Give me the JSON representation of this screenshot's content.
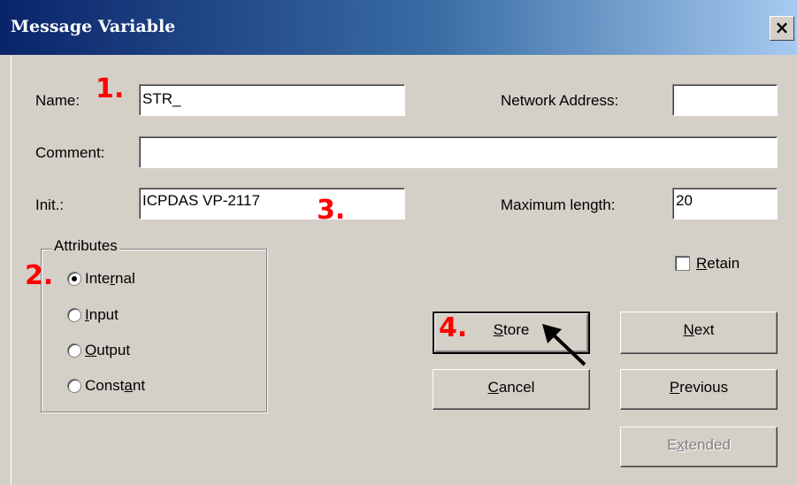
{
  "window": {
    "title": "Message Variable",
    "close_label": "×"
  },
  "fields": {
    "name": {
      "label": "Name:",
      "value": "STR_"
    },
    "network_address": {
      "label": "Network Address:",
      "value": ""
    },
    "comment": {
      "label": "Comment:",
      "value": ""
    },
    "init": {
      "label": "Init.:",
      "value": "ICPDAS VP-2117"
    },
    "max_length": {
      "label": "Maximum length:",
      "value": "20"
    }
  },
  "attributes": {
    "legend": "Attributes",
    "options": [
      {
        "pre": "Inte",
        "ul": "r",
        "post": "nal",
        "selected": true
      },
      {
        "pre": "",
        "ul": "I",
        "post": "nput",
        "selected": false
      },
      {
        "pre": "",
        "ul": "O",
        "post": "utput",
        "selected": false
      },
      {
        "pre": "Const",
        "ul": "a",
        "post": "nt",
        "selected": false
      }
    ]
  },
  "retain": {
    "pre": "",
    "ul": "R",
    "post": "etain",
    "checked": false
  },
  "buttons": {
    "store": {
      "pre": "",
      "ul": "S",
      "post": "tore"
    },
    "next": {
      "pre": "",
      "ul": "N",
      "post": "ext"
    },
    "cancel": {
      "pre": "",
      "ul": "C",
      "post": "ancel"
    },
    "previous": {
      "pre": "",
      "ul": "P",
      "post": "revious"
    },
    "extended": {
      "pre": "E",
      "ul": "x",
      "post": "tended",
      "disabled": true
    }
  },
  "annotations": {
    "step1": "1.",
    "step2": "2.",
    "step3": "3.",
    "step4": "4."
  }
}
